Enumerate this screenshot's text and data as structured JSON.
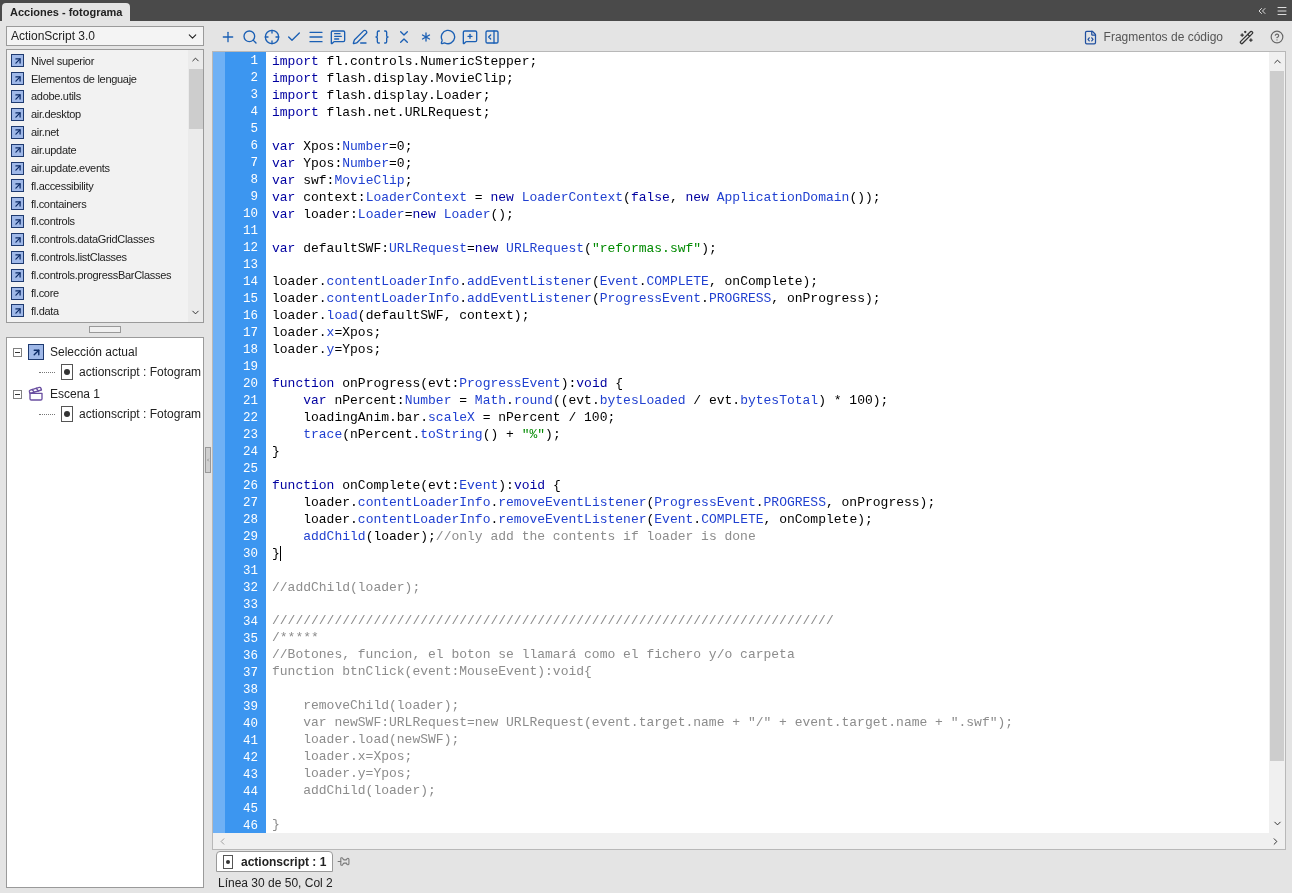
{
  "panel_tab": {
    "label": "Acciones - fotograma",
    "selected": true
  },
  "language_select": {
    "value": "ActionScript 3.0"
  },
  "library": [
    "Nivel superior",
    "Elementos de lenguaje",
    "adobe.utils",
    "air.desktop",
    "air.net",
    "air.update",
    "air.update.events",
    "fl.accessibility",
    "fl.containers",
    "fl.controls",
    "fl.controls.dataGridClasses",
    "fl.controls.listClasses",
    "fl.controls.progressBarClasses",
    "fl.core",
    "fl.data"
  ],
  "tree": [
    {
      "kind": "selection",
      "label": "Selección actual",
      "expanded": true,
      "children": [
        {
          "kind": "script",
          "label": "actionscript : Fotogram"
        }
      ]
    },
    {
      "kind": "scene",
      "label": "Escena 1",
      "expanded": true,
      "children": [
        {
          "kind": "script",
          "label": "actionscript : Fotogram"
        }
      ]
    }
  ],
  "toolbar": {
    "snippets_button": "Fragmentos de código"
  },
  "code": [
    {
      "n": "1",
      "cursor": false,
      "tokens": [
        {
          "kind": "keyword",
          "text": "import"
        },
        {
          "kind": "plain",
          "text": " fl.controls.NumericStepper;"
        }
      ]
    },
    {
      "n": "2",
      "cursor": false,
      "tokens": [
        {
          "kind": "keyword",
          "text": "import"
        },
        {
          "kind": "plain",
          "text": " flash.display.MovieClip;"
        }
      ]
    },
    {
      "n": "3",
      "cursor": false,
      "tokens": [
        {
          "kind": "keyword",
          "text": "import"
        },
        {
          "kind": "plain",
          "text": " flash.display.Loader;"
        }
      ]
    },
    {
      "n": "4",
      "cursor": false,
      "tokens": [
        {
          "kind": "keyword",
          "text": "import"
        },
        {
          "kind": "plain",
          "text": " flash.net.URLRequest;"
        }
      ]
    },
    {
      "n": "5",
      "cursor": false
    },
    {
      "n": "6",
      "cursor": false,
      "tokens": [
        {
          "kind": "keyword",
          "text": "var"
        },
        {
          "kind": "plain",
          "text": " Xpos:"
        },
        {
          "kind": "builtin",
          "text": "Number"
        },
        {
          "kind": "plain",
          "text": "=0;"
        }
      ]
    },
    {
      "n": "7",
      "cursor": false,
      "tokens": [
        {
          "kind": "keyword",
          "text": "var"
        },
        {
          "kind": "plain",
          "text": " Ypos:"
        },
        {
          "kind": "builtin",
          "text": "Number"
        },
        {
          "kind": "plain",
          "text": "=0;"
        }
      ]
    },
    {
      "n": "8",
      "cursor": false,
      "tokens": [
        {
          "kind": "keyword",
          "text": "var"
        },
        {
          "kind": "plain",
          "text": " swf:"
        },
        {
          "kind": "builtin",
          "text": "MovieClip"
        },
        {
          "kind": "plain",
          "text": ";"
        }
      ]
    },
    {
      "n": "9",
      "cursor": false,
      "tokens": [
        {
          "kind": "keyword",
          "text": "var"
        },
        {
          "kind": "plain",
          "text": " context:"
        },
        {
          "kind": "builtin",
          "text": "LoaderContext"
        },
        {
          "kind": "plain",
          "text": " = "
        },
        {
          "kind": "keyword",
          "text": "new "
        },
        {
          "kind": "builtin",
          "text": "LoaderContext"
        },
        {
          "kind": "plain",
          "text": "("
        },
        {
          "kind": "keyword",
          "text": "false"
        },
        {
          "kind": "plain",
          "text": ", "
        },
        {
          "kind": "keyword",
          "text": "new "
        },
        {
          "kind": "builtin",
          "text": "ApplicationDomain"
        },
        {
          "kind": "plain",
          "text": "());"
        }
      ]
    },
    {
      "n": "10",
      "cursor": false,
      "tokens": [
        {
          "kind": "keyword",
          "text": "var"
        },
        {
          "kind": "plain",
          "text": " loader:"
        },
        {
          "kind": "builtin",
          "text": "Loader"
        },
        {
          "kind": "plain",
          "text": "="
        },
        {
          "kind": "keyword",
          "text": "new "
        },
        {
          "kind": "builtin",
          "text": "Loader"
        },
        {
          "kind": "plain",
          "text": "();"
        }
      ]
    },
    {
      "n": "11",
      "cursor": false
    },
    {
      "n": "12",
      "cursor": false,
      "tokens": [
        {
          "kind": "keyword",
          "text": "var"
        },
        {
          "kind": "plain",
          "text": " defaultSWF:"
        },
        {
          "kind": "builtin",
          "text": "URLRequest"
        },
        {
          "kind": "plain",
          "text": "="
        },
        {
          "kind": "keyword",
          "text": "new "
        },
        {
          "kind": "builtin",
          "text": "URLRequest"
        },
        {
          "kind": "plain",
          "text": "("
        },
        {
          "kind": "string",
          "text": "\"reformas.swf\""
        },
        {
          "kind": "plain",
          "text": ");"
        }
      ]
    },
    {
      "n": "13",
      "cursor": false
    },
    {
      "n": "14",
      "cursor": false,
      "tokens": [
        {
          "kind": "plain",
          "text": "loader."
        },
        {
          "kind": "builtin",
          "text": "contentLoaderInfo"
        },
        {
          "kind": "plain",
          "text": "."
        },
        {
          "kind": "builtin",
          "text": "addEventListener"
        },
        {
          "kind": "plain",
          "text": "("
        },
        {
          "kind": "builtin",
          "text": "Event"
        },
        {
          "kind": "plain",
          "text": "."
        },
        {
          "kind": "builtin",
          "text": "COMPLETE"
        },
        {
          "kind": "plain",
          "text": ", onComplete);"
        }
      ]
    },
    {
      "n": "15",
      "cursor": false,
      "tokens": [
        {
          "kind": "plain",
          "text": "loader."
        },
        {
          "kind": "builtin",
          "text": "contentLoaderInfo"
        },
        {
          "kind": "plain",
          "text": "."
        },
        {
          "kind": "builtin",
          "text": "addEventListener"
        },
        {
          "kind": "plain",
          "text": "("
        },
        {
          "kind": "builtin",
          "text": "ProgressEvent"
        },
        {
          "kind": "plain",
          "text": "."
        },
        {
          "kind": "builtin",
          "text": "PROGRESS"
        },
        {
          "kind": "plain",
          "text": ", onProgress);"
        }
      ]
    },
    {
      "n": "16",
      "cursor": false,
      "tokens": [
        {
          "kind": "plain",
          "text": "loader."
        },
        {
          "kind": "builtin",
          "text": "load"
        },
        {
          "kind": "plain",
          "text": "(defaultSWF, context);"
        }
      ]
    },
    {
      "n": "17",
      "cursor": false,
      "tokens": [
        {
          "kind": "plain",
          "text": "loader."
        },
        {
          "kind": "builtin",
          "text": "x"
        },
        {
          "kind": "plain",
          "text": "=Xpos;"
        }
      ]
    },
    {
      "n": "18",
      "cursor": false,
      "tokens": [
        {
          "kind": "plain",
          "text": "loader."
        },
        {
          "kind": "builtin",
          "text": "y"
        },
        {
          "kind": "plain",
          "text": "=Ypos;"
        }
      ]
    },
    {
      "n": "19",
      "cursor": false
    },
    {
      "n": "20",
      "cursor": false,
      "tokens": [
        {
          "kind": "keyword",
          "text": "function"
        },
        {
          "kind": "plain",
          "text": " onProgress(evt:"
        },
        {
          "kind": "builtin",
          "text": "ProgressEvent"
        },
        {
          "kind": "plain",
          "text": "):"
        },
        {
          "kind": "keyword",
          "text": "void"
        },
        {
          "kind": "plain",
          "text": " {"
        }
      ]
    },
    {
      "n": "21",
      "cursor": false,
      "tokens": [
        {
          "kind": "keyword",
          "text": "    var"
        },
        {
          "kind": "plain",
          "text": " nPercent:"
        },
        {
          "kind": "builtin",
          "text": "Number"
        },
        {
          "kind": "plain",
          "text": " = "
        },
        {
          "kind": "builtin",
          "text": "Math"
        },
        {
          "kind": "plain",
          "text": "."
        },
        {
          "kind": "builtin",
          "text": "round"
        },
        {
          "kind": "plain",
          "text": "((evt."
        },
        {
          "kind": "builtin",
          "text": "bytesLoaded"
        },
        {
          "kind": "plain",
          "text": " / evt."
        },
        {
          "kind": "builtin",
          "text": "bytesTotal"
        },
        {
          "kind": "plain",
          "text": ") * 100);"
        }
      ]
    },
    {
      "n": "22",
      "cursor": false,
      "tokens": [
        {
          "kind": "plain",
          "text": "    loadingAnim.bar."
        },
        {
          "kind": "builtin",
          "text": "scaleX"
        },
        {
          "kind": "plain",
          "text": " = nPercent / 100;"
        }
      ]
    },
    {
      "n": "23",
      "cursor": false,
      "tokens": [
        {
          "kind": "builtin",
          "text": "    trace"
        },
        {
          "kind": "plain",
          "text": "(nPercent."
        },
        {
          "kind": "builtin",
          "text": "toString"
        },
        {
          "kind": "plain",
          "text": "() + "
        },
        {
          "kind": "string",
          "text": "\"%\""
        },
        {
          "kind": "plain",
          "text": ");"
        }
      ]
    },
    {
      "n": "24",
      "cursor": false,
      "tokens": [
        {
          "kind": "plain",
          "text": "}"
        }
      ]
    },
    {
      "n": "25",
      "cursor": false
    },
    {
      "n": "26",
      "cursor": false,
      "tokens": [
        {
          "kind": "keyword",
          "text": "function"
        },
        {
          "kind": "plain",
          "text": " onComplete(evt:"
        },
        {
          "kind": "builtin",
          "text": "Event"
        },
        {
          "kind": "plain",
          "text": "):"
        },
        {
          "kind": "keyword",
          "text": "void"
        },
        {
          "kind": "plain",
          "text": " {"
        }
      ]
    },
    {
      "n": "27",
      "cursor": false,
      "tokens": [
        {
          "kind": "plain",
          "text": "    loader."
        },
        {
          "kind": "builtin",
          "text": "contentLoaderInfo"
        },
        {
          "kind": "plain",
          "text": "."
        },
        {
          "kind": "builtin",
          "text": "removeEventListener"
        },
        {
          "kind": "plain",
          "text": "("
        },
        {
          "kind": "builtin",
          "text": "ProgressEvent"
        },
        {
          "kind": "plain",
          "text": "."
        },
        {
          "kind": "builtin",
          "text": "PROGRESS"
        },
        {
          "kind": "plain",
          "text": ", onProgress);"
        }
      ]
    },
    {
      "n": "28",
      "cursor": false,
      "tokens": [
        {
          "kind": "plain",
          "text": "    loader."
        },
        {
          "kind": "builtin",
          "text": "contentLoaderInfo"
        },
        {
          "kind": "plain",
          "text": "."
        },
        {
          "kind": "builtin",
          "text": "removeEventListener"
        },
        {
          "kind": "plain",
          "text": "("
        },
        {
          "kind": "builtin",
          "text": "Event"
        },
        {
          "kind": "plain",
          "text": "."
        },
        {
          "kind": "builtin",
          "text": "COMPLETE"
        },
        {
          "kind": "plain",
          "text": ", onComplete);"
        }
      ]
    },
    {
      "n": "29",
      "cursor": false,
      "tokens": [
        {
          "kind": "builtin",
          "text": "    addChild"
        },
        {
          "kind": "plain",
          "text": "(loader);"
        },
        {
          "kind": "comment",
          "text": "//only add the contents if loader is done"
        }
      ]
    },
    {
      "n": "30",
      "cursor": true,
      "tokens": [
        {
          "kind": "plain",
          "text": "}"
        }
      ]
    },
    {
      "n": "31",
      "cursor": false
    },
    {
      "n": "32",
      "cursor": false,
      "tokens": [
        {
          "kind": "comment",
          "text": "//addChild(loader);"
        }
      ]
    },
    {
      "n": "33",
      "cursor": false
    },
    {
      "n": "34",
      "cursor": false,
      "tokens": [
        {
          "kind": "comment",
          "text": "////////////////////////////////////////////////////////////////////////"
        }
      ]
    },
    {
      "n": "35",
      "cursor": false,
      "tokens": [
        {
          "kind": "comment",
          "text": "/*****"
        }
      ]
    },
    {
      "n": "36",
      "cursor": false,
      "tokens": [
        {
          "kind": "comment",
          "text": "//Botones, funcion, el boton se llamará como el fichero y/o carpeta"
        }
      ]
    },
    {
      "n": "37",
      "cursor": false,
      "tokens": [
        {
          "kind": "comment",
          "text": "function btnClick(event:MouseEvent):void{"
        }
      ]
    },
    {
      "n": "38",
      "cursor": false
    },
    {
      "n": "39",
      "cursor": false,
      "tokens": [
        {
          "kind": "comment",
          "text": "    removeChild(loader);"
        }
      ]
    },
    {
      "n": "40",
      "cursor": false,
      "tokens": [
        {
          "kind": "comment",
          "text": "    var newSWF:URLRequest=new URLRequest(event.target.name + \"/\" + event.target.name + \".swf\");"
        }
      ]
    },
    {
      "n": "41",
      "cursor": false,
      "tokens": [
        {
          "kind": "comment",
          "text": "    loader.load(newSWF);"
        }
      ]
    },
    {
      "n": "42",
      "cursor": false,
      "tokens": [
        {
          "kind": "comment",
          "text": "    loader.x=Xpos;"
        }
      ]
    },
    {
      "n": "43",
      "cursor": false,
      "tokens": [
        {
          "kind": "comment",
          "text": "    loader.y=Ypos;"
        }
      ]
    },
    {
      "n": "44",
      "cursor": false,
      "tokens": [
        {
          "kind": "comment",
          "text": "    addChild(loader);"
        }
      ]
    },
    {
      "n": "45",
      "cursor": false
    },
    {
      "n": "46",
      "cursor": false,
      "tokens": [
        {
          "kind": "comment",
          "text": "}"
        }
      ]
    }
  ],
  "script_tabs": [
    {
      "label": "actionscript : 1",
      "selected": true
    }
  ],
  "status_bar": "Línea 30 de 50, Col 2"
}
